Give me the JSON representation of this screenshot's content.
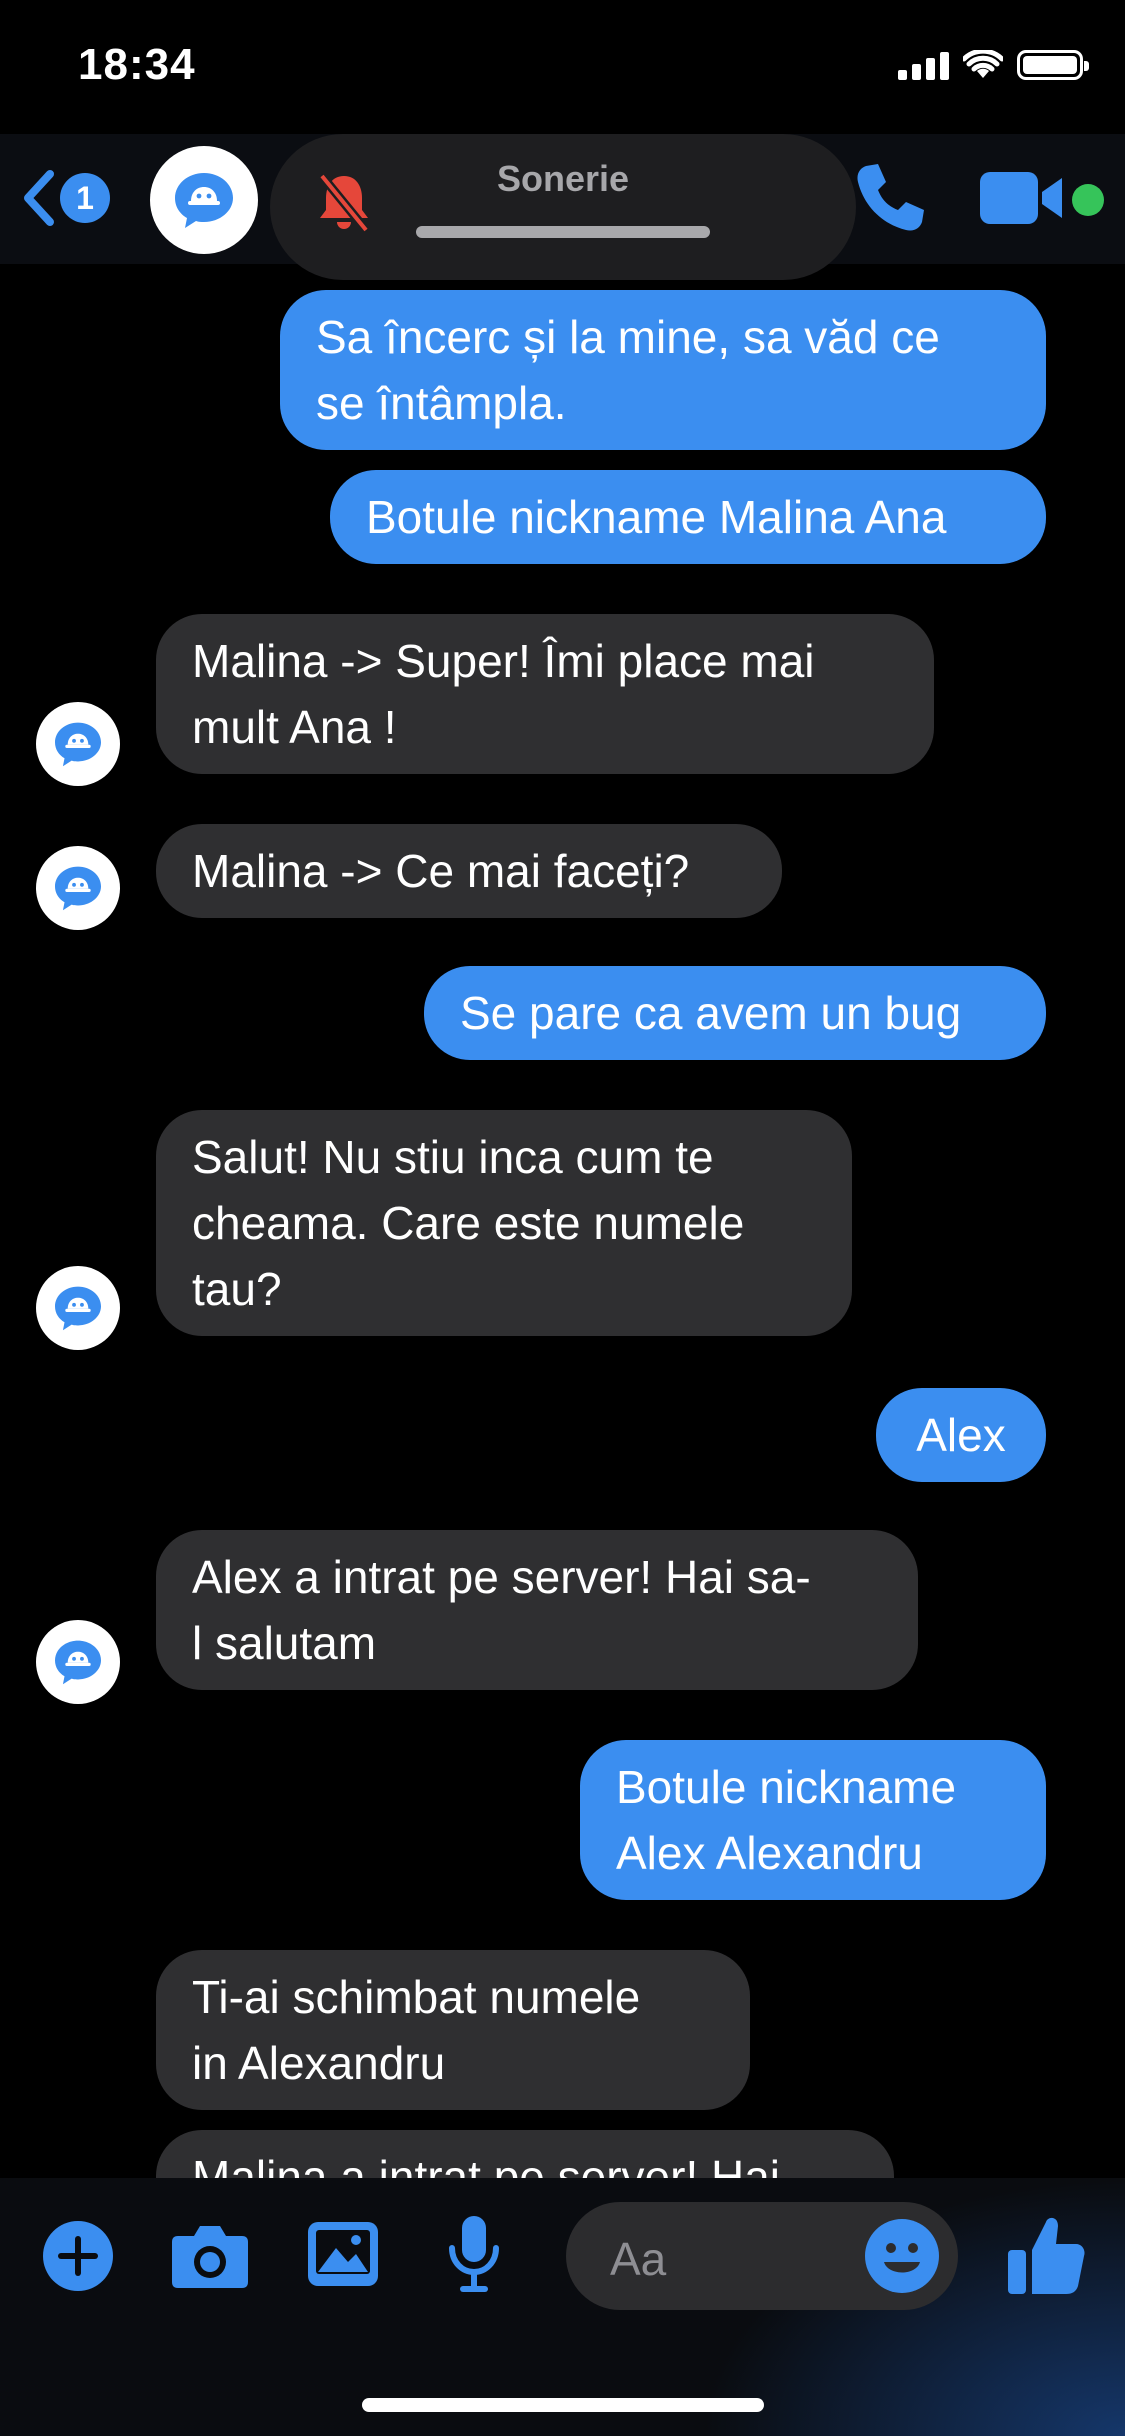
{
  "status_bar": {
    "time": "18:34"
  },
  "header": {
    "back_badge": "1",
    "ringer_label": "Sonerie",
    "icons": [
      "back-chevron-icon",
      "bot-avatar-icon",
      "bell-muted-icon",
      "phone-icon",
      "video-camera-icon"
    ]
  },
  "messages": [
    {
      "dir": "out",
      "text": "Sa încerc și la mine, sa văd ce\nse întâmpla."
    },
    {
      "dir": "out",
      "text": "Botule nickname Malina Ana"
    },
    {
      "dir": "in",
      "text": "Malina -> Super! Îmi place mai\nmult Ana !"
    },
    {
      "dir": "in",
      "text": "Malina -> Ce mai faceți?"
    },
    {
      "dir": "out",
      "text": "Se pare ca avem un bug"
    },
    {
      "dir": "in",
      "text": "Salut! Nu stiu inca cum te\ncheama. Care este numele\ntau?"
    },
    {
      "dir": "out",
      "text": "Alex"
    },
    {
      "dir": "in",
      "text": "Alex a intrat pe server! Hai sa-\nl salutam"
    },
    {
      "dir": "out",
      "text": "Botule nickname\nAlex Alexandru"
    },
    {
      "dir": "in",
      "text": "Ti-ai schimbat numele\nin Alexandru"
    },
    {
      "dir": "in",
      "text": "Malina a intrat pe server! Hai"
    }
  ],
  "composer": {
    "placeholder": "Aa",
    "icons": [
      "plus-icon",
      "camera-icon",
      "photo-icon",
      "microphone-icon",
      "emoji-icon",
      "thumbs-up-icon"
    ]
  },
  "colors": {
    "accent": "#3b8ef0",
    "incoming": "#2f2f31",
    "online": "#36c45a",
    "muted_bell": "#e5473a"
  }
}
